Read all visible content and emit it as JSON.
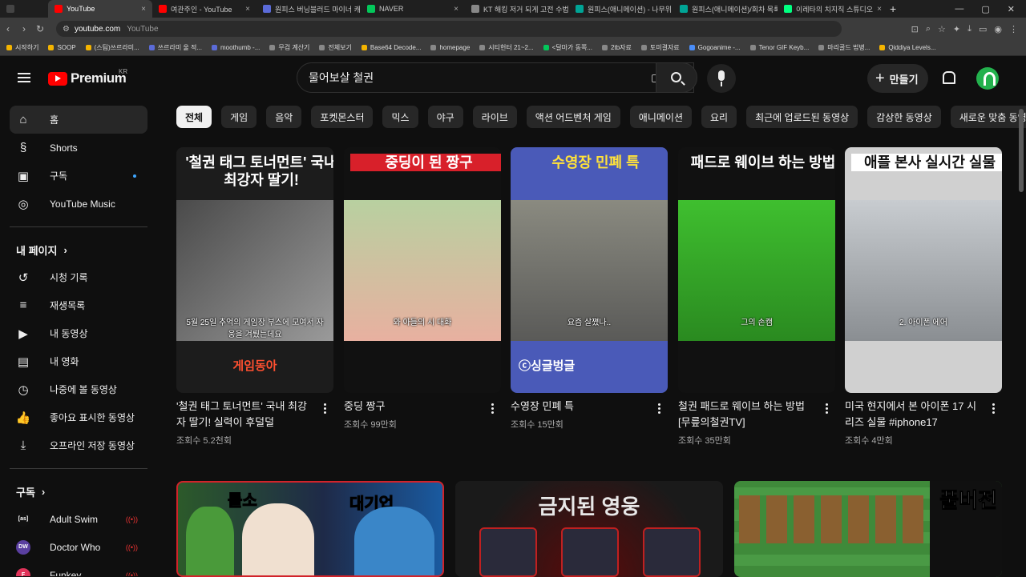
{
  "browser": {
    "tabs": [
      {
        "label": "",
        "favicon_color": "#444444",
        "active": false
      },
      {
        "label": "YouTube",
        "favicon_color": "#ff0000",
        "active": true
      },
      {
        "label": "여관주인 - YouTube",
        "favicon_color": "#ff0000",
        "active": false
      },
      {
        "label": "원피스 버닝블러드 마이너 캐",
        "favicon_color": "#5b6bd8",
        "active": false
      },
      {
        "label": "NAVER",
        "favicon_color": "#03c75a",
        "active": false
      },
      {
        "label": "KT 해킹 저거 되게 고전 수법",
        "favicon_color": "#888888",
        "active": false
      },
      {
        "label": "원피스(애니메이션) - 나무위",
        "favicon_color": "#00a495",
        "active": false
      },
      {
        "label": "원피스(애니메이션)/회차 목록",
        "favicon_color": "#00a495",
        "active": false
      },
      {
        "label": "이레타의 치지직 스튜디오",
        "favicon_color": "#00ff80",
        "active": false
      }
    ],
    "new_tab": "+",
    "address": {
      "host": "youtube.com",
      "subtitle": "YouTube"
    },
    "bookmarks": [
      {
        "label": "시작하기",
        "color": "#f4b400"
      },
      {
        "label": "SOOP",
        "color": "#f4b400"
      },
      {
        "label": "(스팀)쓰르라미...",
        "color": "#f4b400"
      },
      {
        "label": "쓰르라미 울 적...",
        "color": "#5b6bd8"
      },
      {
        "label": "moothumb -...",
        "color": "#5b6bd8"
      },
      {
        "label": "무검 계산기",
        "color": "#888888"
      },
      {
        "label": "전체보기",
        "color": "#888888"
      },
      {
        "label": "Base64 Decode...",
        "color": "#f4b400"
      },
      {
        "label": "homepage",
        "color": "#888888"
      },
      {
        "label": "시티헌터 21~2...",
        "color": "#888888"
      },
      {
        "label": "<달마가 동쪽...",
        "color": "#03c75a"
      },
      {
        "label": "2tb자료",
        "color": "#888888"
      },
      {
        "label": "토미결자료",
        "color": "#888888"
      },
      {
        "label": "Gogoanime -...",
        "color": "#4a8df8"
      },
      {
        "label": "Tenor GIF Keyb...",
        "color": "#888888"
      },
      {
        "label": "마리골드 법병...",
        "color": "#888888"
      },
      {
        "label": "Qiddiya Levels...",
        "color": "#f4b400"
      }
    ]
  },
  "header": {
    "logo_text": "Premium",
    "logo_region": "KR",
    "search_value": "물어보살 철권",
    "create_label": "만들기"
  },
  "sidebar": {
    "main": [
      {
        "label": "홈",
        "icon": "home-icon",
        "glyph": "⌂",
        "active": true
      },
      {
        "label": "Shorts",
        "icon": "shorts-icon",
        "glyph": "§",
        "active": false
      },
      {
        "label": "구독",
        "icon": "subscriptions-icon",
        "glyph": "▣",
        "active": false
      },
      {
        "label": "YouTube Music",
        "icon": "music-icon",
        "glyph": "◎",
        "active": false
      }
    ],
    "my_page_title": "내 페이지",
    "my_page": [
      {
        "label": "시청 기록",
        "icon": "history-icon",
        "glyph": "↺"
      },
      {
        "label": "재생목록",
        "icon": "playlist-icon",
        "glyph": "≡"
      },
      {
        "label": "내 동영상",
        "icon": "my-videos-icon",
        "glyph": "▶"
      },
      {
        "label": "내 영화",
        "icon": "movies-icon",
        "glyph": "▤"
      },
      {
        "label": "나중에 볼 동영상",
        "icon": "watch-later-icon",
        "glyph": "◷"
      },
      {
        "label": "좋아요 표시한 동영상",
        "icon": "like-icon",
        "glyph": "👍"
      },
      {
        "label": "오프라인 저장 동영상",
        "icon": "download-icon",
        "glyph": "⤓"
      }
    ],
    "subs_title": "구독",
    "subscriptions": [
      {
        "label": "Adult Swim",
        "avatar_text": "[as]",
        "avatar_bg": "#111111",
        "avatar_fg": "#ffffff"
      },
      {
        "label": "Doctor Who",
        "avatar_text": "DW",
        "avatar_bg": "#5a3fa0",
        "avatar_fg": "#ffffff"
      },
      {
        "label": "Funkey",
        "avatar_text": "F",
        "avatar_bg": "#e0335a",
        "avatar_fg": "#ffffff"
      }
    ]
  },
  "chips": [
    "전체",
    "게임",
    "음악",
    "포켓몬스터",
    "믹스",
    "야구",
    "라이브",
    "액션 어드벤처 게임",
    "애니메이션",
    "요리",
    "최근에 업로드된 동영상",
    "감상한 동영상",
    "새로운 맞춤 동영상"
  ],
  "shorts": [
    {
      "title": "'철권 태그 토너먼트' 국내 최강자 딸기! 실력이 후덜덜",
      "views": "조회수 5.2천회",
      "overlay_top": "'철권 태그 토너먼트' 국내 최강자 딸기!",
      "overlay_caption": "5월 25일 추억의 게임장 부스에 모여서 자웅을 겨뤘는데요",
      "overlay_brand": "게임동아"
    },
    {
      "title": "중딩 짱구",
      "views": "조회수 99만회",
      "overlay_top": "중딩이 된 짱구",
      "overlay_caption": "와 아들의 시 대화"
    },
    {
      "title": "수영장 민폐 특",
      "views": "조회수 15만회",
      "overlay_top": "수영장 민폐 특",
      "overlay_caption": "요즘 살쪘나..",
      "overlay_brand": "ⓒ싱글벙글"
    },
    {
      "title": "철권 패드로 웨이브 하는 방법 [무릎의철권TV]",
      "views": "조회수 35만회",
      "overlay_top": "패드로 웨이브 하는 방법",
      "overlay_caption": "그의 손캠"
    },
    {
      "title": "미국 현지에서 본 아이폰 17 시리즈 실물 #iphone17",
      "views": "조회수 4만회",
      "overlay_top": "애플 본사 실시간 실물",
      "overlay_caption": "2. 아이폰 에어"
    }
  ],
  "videos": [
    {
      "overlay_a": "롤소",
      "overlay_b": "대기업"
    },
    {
      "overlay_a": "금지된 영웅"
    },
    {
      "overlay_a": "풀버전"
    }
  ]
}
